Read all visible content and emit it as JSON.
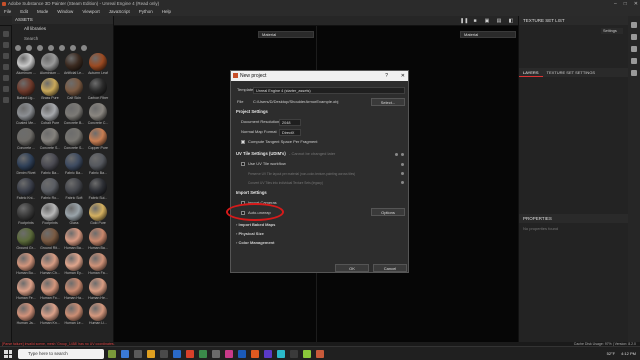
{
  "window": {
    "title": "Adobe Substance 3D Painter (Steam Edition) - Unreal Engine 4 (Read only)",
    "controls": [
      "–",
      "□",
      "✕"
    ]
  },
  "menu": [
    "File",
    "Edit",
    "Mode",
    "Window",
    "Viewport",
    "JavaScript",
    "Python",
    "Help"
  ],
  "assets": {
    "title": "ASSETS",
    "library": "All libraries",
    "search": "Search",
    "items": [
      {
        "label": "Aluminum ...",
        "color": "#c9c9c9"
      },
      {
        "label": "Aluminium ...",
        "color": "#9a9a9a"
      },
      {
        "label": "Artificial Le...",
        "color": "#3b2a20"
      },
      {
        "label": "Autumn Leaf",
        "color": "#9b4a22"
      },
      {
        "label": "Baked Lig...",
        "color": "#6f3a2b"
      },
      {
        "label": "Brass Pure",
        "color": "#c9a85a"
      },
      {
        "label": "Calf Skin",
        "color": "#7b5a42"
      },
      {
        "label": "Carbon Fiber",
        "color": "#2a2a2a"
      },
      {
        "label": "Coated Me...",
        "color": "#8c8f93"
      },
      {
        "label": "Cobalt Pure",
        "color": "#a7a9ad"
      },
      {
        "label": "Concrete B...",
        "color": "#7c7a76"
      },
      {
        "label": "Concrete C...",
        "color": "#8a8680"
      },
      {
        "label": "Concrete ...",
        "color": "#6d6b67"
      },
      {
        "label": "Concrete S...",
        "color": "#85827d"
      },
      {
        "label": "Concrete S...",
        "color": "#777570"
      },
      {
        "label": "Copper Pure",
        "color": "#c77d52"
      },
      {
        "label": "Denim Rivet",
        "color": "#2f4058"
      },
      {
        "label": "Fabric Ba...",
        "color": "#4a4a52"
      },
      {
        "label": "Fabric Ba...",
        "color": "#3d4a60"
      },
      {
        "label": "Fabric Ba...",
        "color": "#55585e"
      },
      {
        "label": "Fabric Kni...",
        "color": "#3b3f4a"
      },
      {
        "label": "Fabric Ro...",
        "color": "#5a5d63"
      },
      {
        "label": "Fabric Soft",
        "color": "#44464c"
      },
      {
        "label": "Fabric Sui...",
        "color": "#2d2f35"
      },
      {
        "label": "Footprints",
        "color": "#3a3a3a"
      },
      {
        "label": "Footprints",
        "color": "#b8b8b8"
      },
      {
        "label": "Glass",
        "color": "#9aa4aa"
      },
      {
        "label": "Gold Pure",
        "color": "#d4b060"
      },
      {
        "label": "Ground Gr...",
        "color": "#5b6a3a"
      },
      {
        "label": "Ground Rit...",
        "color": "#7a5a42"
      },
      {
        "label": "Human Ba...",
        "color": "#d89a82"
      },
      {
        "label": "Human Ba...",
        "color": "#c9876c"
      },
      {
        "label": "Human Bu...",
        "color": "#d2957c"
      },
      {
        "label": "Human Ch...",
        "color": "#d69c84"
      },
      {
        "label": "Human Ey...",
        "color": "#e0a58c"
      },
      {
        "label": "Human Fa...",
        "color": "#cf9278"
      },
      {
        "label": "Human Fe...",
        "color": "#dca088"
      },
      {
        "label": "Human Fo...",
        "color": "#d4967c"
      },
      {
        "label": "Human Ha...",
        "color": "#c98a70"
      },
      {
        "label": "Human He...",
        "color": "#d89c82"
      },
      {
        "label": "Human Ja...",
        "color": "#d2927a"
      },
      {
        "label": "Human Kn...",
        "color": "#dba18a"
      },
      {
        "label": "Human Le...",
        "color": "#cc8e74"
      },
      {
        "label": "Human Li...",
        "color": "#d5987e"
      }
    ]
  },
  "viewport": {
    "left_mode": "Material",
    "right_mode": "Material"
  },
  "right_panel": {
    "texture_set_list": "TEXTURE SET LIST",
    "settings": "Settings",
    "tabs": [
      "LAYERS",
      "TEXTURE SET SETTINGS"
    ],
    "properties": "PROPERTIES",
    "no_properties": "No properties found"
  },
  "dialog": {
    "title": "New project",
    "help": "?",
    "close": "✕",
    "template_label": "Template",
    "template_value": "Unreal Engine 4 (starter_assets)",
    "file_label": "File",
    "file_value": "C:/Users/D/Desktop/ShoulderArmorExample.obj",
    "select_button": "Select...",
    "project_settings": "Project Settings",
    "doc_res_label": "Document Resolution",
    "doc_res_value": "2048",
    "normal_format_label": "Normal Map Format",
    "normal_format_value": "DirectX",
    "tangent_label": "Compute Tangent Space Per Fragment",
    "uv_tile_title": "UV Tile Settings (UDIM's)",
    "uv_tile_note": "- Cannot be changed later",
    "uv_tile_workflow": "Use UV Tile workflow",
    "uv_opt1": "Preserve UV Tile layout per material (non-color-texture-painting across tiles)",
    "uv_opt2": "Convert UV Tiles into individual Texture Sets (legacy)",
    "import_settings": "Import Settings",
    "import_cameras": "Import Cameras",
    "auto_unwrap": "Auto-unwrap",
    "options_button": "Options",
    "import_baked_maps": "Import Baked Maps",
    "physical_size": "Physical Size",
    "color_management": "Color Management",
    "ok_button": "OK",
    "cancel_button": "Cancel"
  },
  "status": {
    "message": "[Parse failure] Invalid scene, mesh 'Group_1458' has no UV coordinates.",
    "cache": "Cache Disk Usage: 97% | Version: 8.2.0"
  },
  "taskbar": {
    "search_placeholder": "Type here to search",
    "temp": "52°F",
    "time": "4:12 PM"
  }
}
